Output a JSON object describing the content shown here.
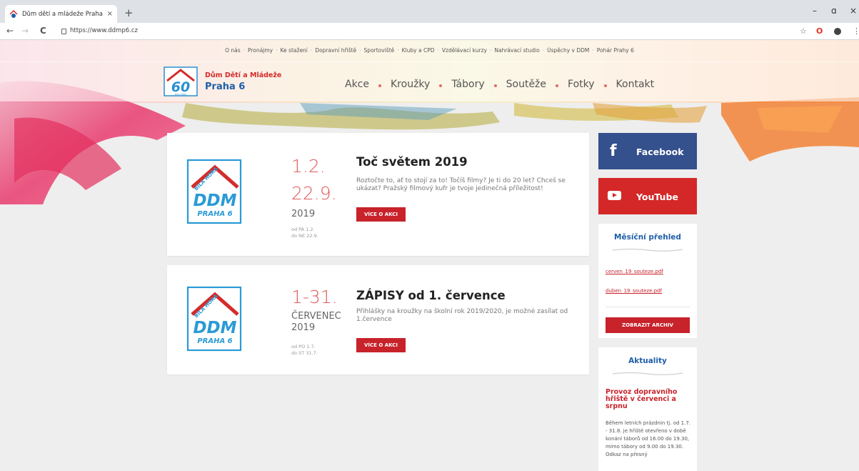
{
  "browser": {
    "tab_title": "Dům dětí a mládeže Praha 6",
    "tab_close": "×",
    "new_tab": "+",
    "url": "https://www.ddmp6.cz",
    "back": "←",
    "forward": "→",
    "reload": "C",
    "minimize": "–",
    "maximize": "ɑ",
    "close": "×",
    "star": "☆",
    "opera": "O",
    "menu": "⋮"
  },
  "top_nav": [
    "O nás",
    "Pronájmy",
    "Ke stažení",
    "Dopravní hřiště",
    "Sportoviště",
    "Kluby a CPD",
    "Vzdělávací kurzy",
    "Nahrávací studio",
    "Úspěchy v DDM",
    "Pohár Prahy 6"
  ],
  "top_nav_sep": "·",
  "brand": {
    "line1": "Dům Dětí a Mládeže",
    "line2": "Praha 6",
    "logo_number": "60",
    "logo_text": "BÍLÁ HORA"
  },
  "main_nav": [
    "Akce",
    "Kroužky",
    "Tábory",
    "Soutěže",
    "Fotky",
    "Kontakt"
  ],
  "events": [
    {
      "date_range_line1": "1.2.",
      "date_range_line2": "22.9.",
      "year": "2019",
      "from": "od PÁ 1.2.",
      "to": "do NE 22.9.",
      "title": "Toč světem 2019",
      "description": "Roztočte to, ať to stojí za to! Točíš filmy? Je ti do 20 let? Chceš se ukázat? Pražský filmový kufr je tvoje jedinečná příležitost!",
      "button": "VÍCE O AKCI"
    },
    {
      "date_range": "1-31.",
      "month": "ČERVENEC",
      "year": "2019",
      "from": "od PO 1.7.",
      "to": "do ST 31.7.",
      "title": "ZÁPISY od 1. července",
      "description": "Přihlášky na kroužky na školní rok 2019/2020, je možné zasílat od 1.července",
      "button": "VÍCE O AKCI"
    }
  ],
  "logo_card": {
    "arc_text": "BÍLÁ HORA",
    "big": "DDM",
    "small": "PRAHA 6"
  },
  "social": {
    "facebook_icon": "f",
    "facebook": "Facebook",
    "youtube": "YouTube"
  },
  "monthly": {
    "title": "Měsíční přehled",
    "links": [
      "cerven_19_souteze.pdf",
      "duben_19_souteze.pdf"
    ],
    "archive_button": "ZOBRAZIT ARCHIV"
  },
  "news": {
    "title": "Aktuality",
    "item_title": "Provoz dopravního hřiště v červenci a srpnu",
    "item_text": "Během letních prázdnin tj. od 1.7. - 31.8. je hřiště otevřeno v době konání táborů od 16.00 do 19.30, mimo tábory od 9.00 do 19.30. Odkaz na přesný"
  },
  "colors": {
    "accent_red": "#c8222b",
    "brand_blue": "#1f5fa8",
    "facebook": "#34508d",
    "youtube": "#d42828"
  }
}
